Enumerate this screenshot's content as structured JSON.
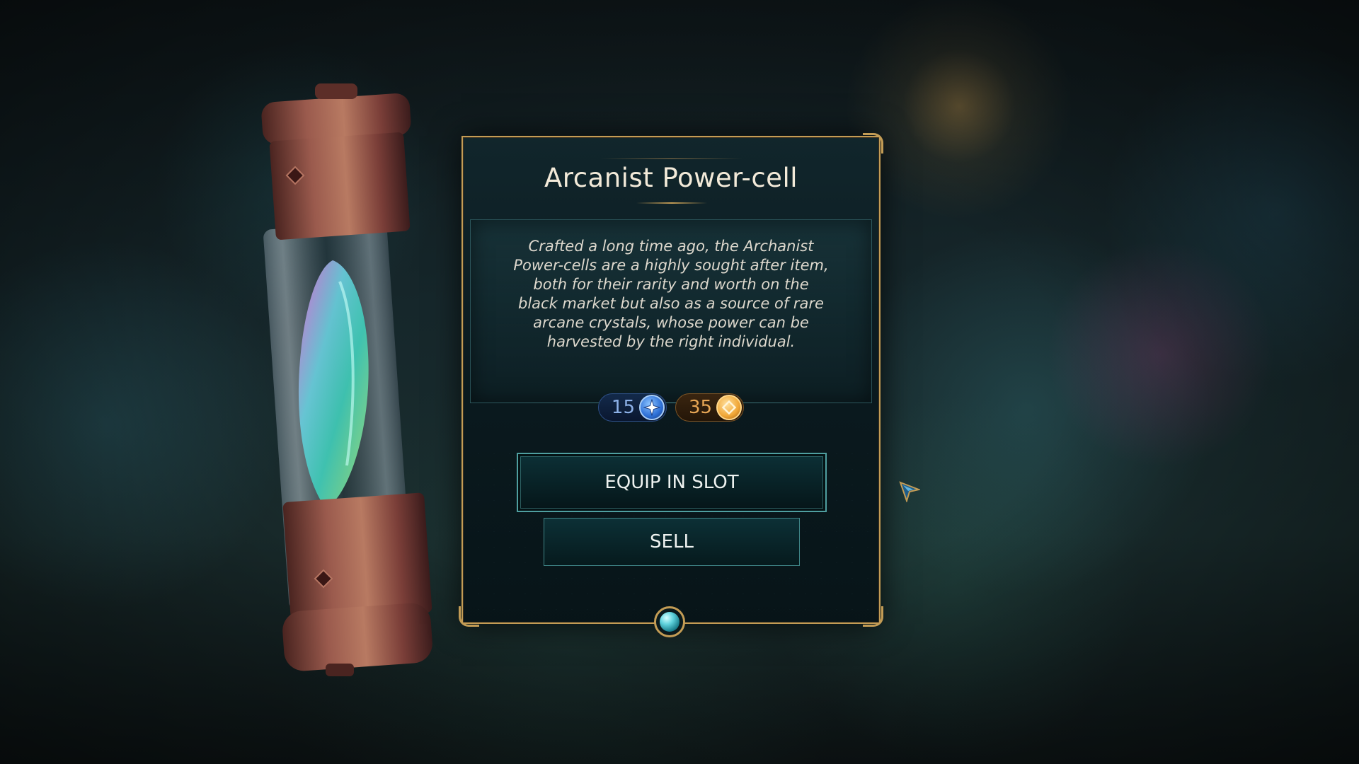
{
  "item": {
    "name": "Arcanist Power-cell",
    "description": "Crafted a long time ago, the Archanist Power-cells are a highly sought after item, both for their rarity and worth on the black market but also as a source of rare arcane crystals, whose power can be harvested by the right individual.",
    "costs": [
      {
        "value": "15",
        "icon": "star-gem-icon",
        "color": "#3d7bdb"
      },
      {
        "value": "35",
        "icon": "gold-coin-icon",
        "color": "#f0a636"
      }
    ]
  },
  "actions": {
    "equip_label": "EQUIP IN SLOT",
    "sell_label": "SELL"
  },
  "theme": {
    "frame_gold": "#c39c55",
    "button_teal": "#4f9fa0"
  }
}
